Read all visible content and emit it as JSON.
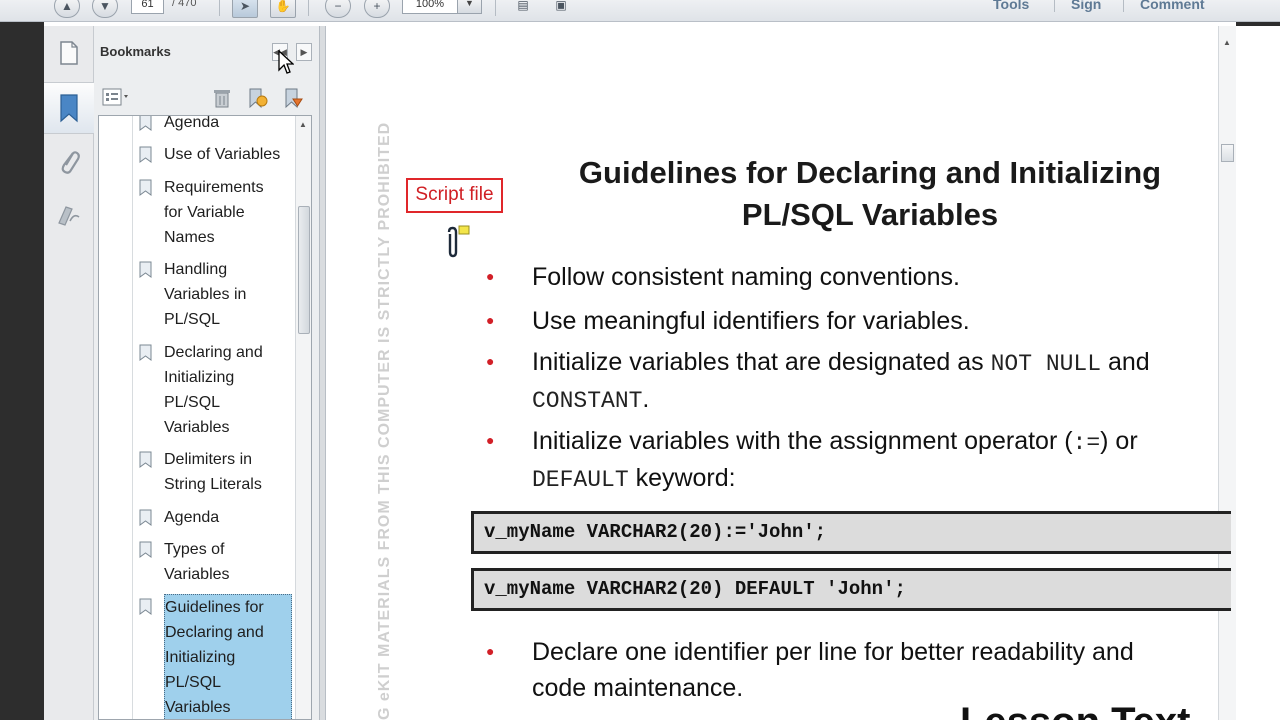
{
  "toolbar": {
    "page_current": "61",
    "page_total": "/ 470",
    "zoom": "100%",
    "links": [
      "Tools",
      "Sign",
      "Comment"
    ]
  },
  "bookmarks": {
    "title": "Bookmarks",
    "items": [
      {
        "label": "Agenda"
      },
      {
        "label": "Use of Variables"
      },
      {
        "label": "Requirements\nfor Variable\nNames"
      },
      {
        "label": "Handling\nVariables in\nPL/SQL"
      },
      {
        "label": "Declaring and\nInitializing\nPL/SQL\nVariables"
      },
      {
        "label": "Delimiters in\nString Literals"
      },
      {
        "label": "Agenda"
      },
      {
        "label": "Types of\nVariables"
      },
      {
        "label": "Guidelines for\nDeclaring and\nInitializing\nPL/SQL\nVariables",
        "selected": true
      }
    ]
  },
  "document": {
    "watermark": "G eKIT MATERIALS FROM THIS COMPUTER IS STRICTLY PROHIBITED",
    "title_line1": "Guidelines for Declaring and Initializing",
    "title_line2": "PL/SQL Variables",
    "annotation_label": "Script file",
    "bullets": {
      "b1": "Follow consistent naming conventions.",
      "b2": "Use meaningful identifiers for variables.",
      "b3_part1": "Initialize variables that are designated as ",
      "b3_code1": "NOT NULL",
      "b3_part2": " and",
      "b3_code2": "CONSTANT",
      "b3_part3": ".",
      "b4_part1": "Initialize variables with the assignment operator (",
      "b4_code1": ":=",
      "b4_part2": ") or",
      "b4_code2": "DEFAULT",
      "b4_part3": " keyword:",
      "b5_line1": "Declare one identifier per line for better readability and",
      "b5_line2": "code maintenance."
    },
    "code1": "v_myName VARCHAR2(20):='John';",
    "code2": "v_myName VARCHAR2(20) DEFAULT 'John';",
    "bottom_partial": "Lesson Text"
  },
  "colors": {
    "accent_red": "#d21f27",
    "selection": "#9fd0ec",
    "link": "#5f7a95"
  }
}
